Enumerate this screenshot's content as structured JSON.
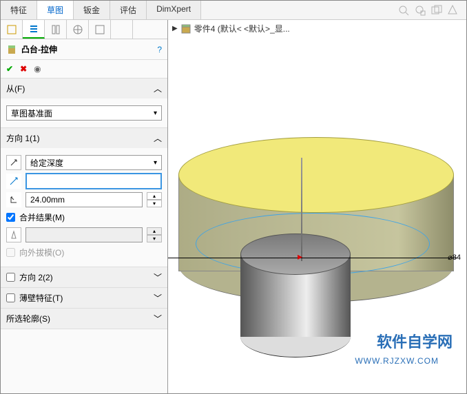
{
  "tabs": [
    "特征",
    "草图",
    "钣金",
    "评估",
    "DimXpert"
  ],
  "activeTab": 1,
  "breadcrumb": "零件4  (默认< <默认>_显...",
  "feature": {
    "title": "凸台-拉伸",
    "help": "?"
  },
  "confirm": {
    "ok": "✔",
    "cancel": "✖",
    "eye": "👁"
  },
  "sections": {
    "from": {
      "label": "从(F)",
      "value": "草图基准面"
    },
    "dir1": {
      "label": "方向 1(1)",
      "end": "给定深度",
      "depth": "24.00mm",
      "merge": "合并结果(M)",
      "mergeChecked": true,
      "draft": "向外拔模(O)",
      "draftChecked": false
    },
    "dir2": {
      "label": "方向 2(2)",
      "checked": false
    },
    "thin": {
      "label": "薄壁特征(T)",
      "checked": false
    },
    "contour": {
      "label": "所选轮廓(S)"
    }
  },
  "dimension": "⌀84",
  "watermark": {
    "line1": "软件自学网",
    "line2": "WWW.RJZXW.COM"
  }
}
